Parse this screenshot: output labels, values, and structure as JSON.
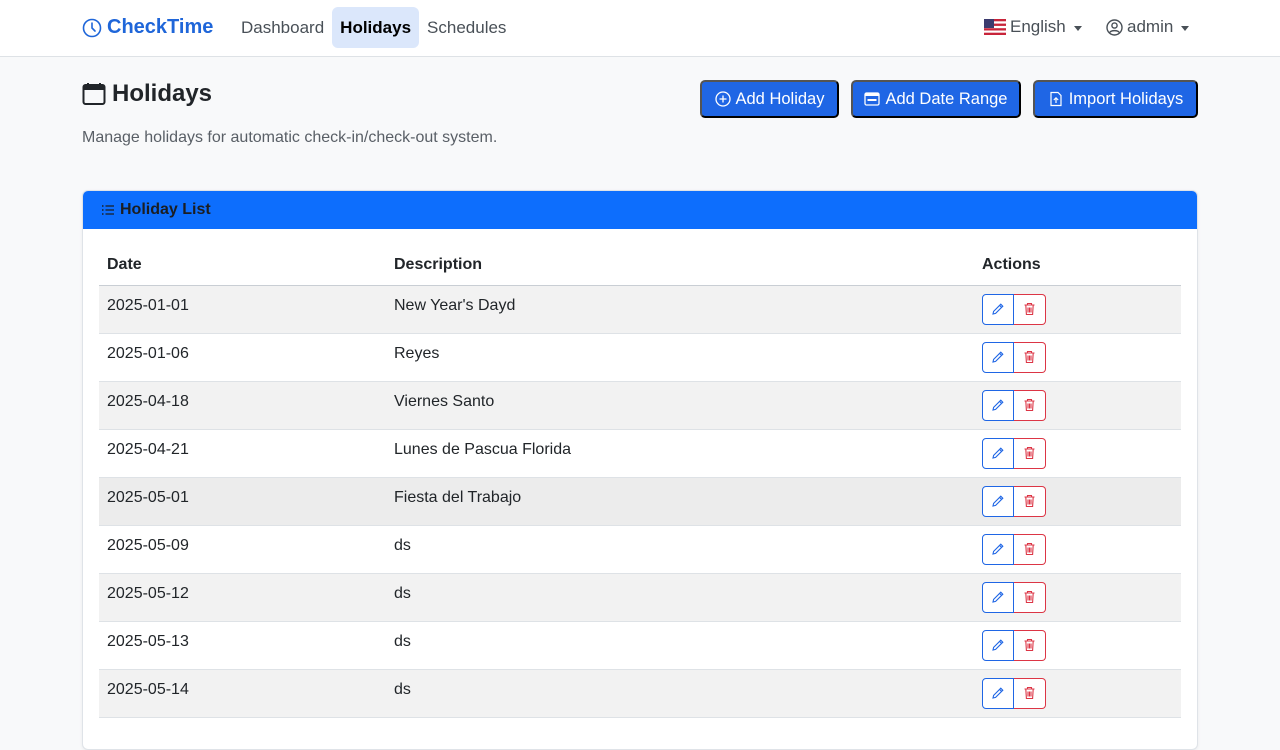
{
  "brand": {
    "name": "CheckTime"
  },
  "nav": {
    "links": [
      {
        "label": "Dashboard"
      },
      {
        "label": "Holidays"
      },
      {
        "label": "Schedules"
      }
    ],
    "language": "English",
    "user": "admin"
  },
  "header": {
    "title": "Holidays",
    "subtitle": "Manage holidays for automatic check-in/check-out system.",
    "buttons": {
      "add_holiday": "Add Holiday",
      "add_date_range": "Add Date Range",
      "import_holidays": "Import Holidays"
    }
  },
  "card": {
    "title": "Holiday List",
    "columns": {
      "date": "Date",
      "description": "Description",
      "actions": "Actions"
    },
    "rows": [
      {
        "date": "2025-01-01",
        "description": "New Year's Dayd"
      },
      {
        "date": "2025-01-06",
        "description": "Reyes"
      },
      {
        "date": "2025-04-18",
        "description": "Viernes Santo"
      },
      {
        "date": "2025-04-21",
        "description": "Lunes de Pascua Florida"
      },
      {
        "date": "2025-05-01",
        "description": "Fiesta del Trabajo"
      },
      {
        "date": "2025-05-09",
        "description": "ds"
      },
      {
        "date": "2025-05-12",
        "description": "ds"
      },
      {
        "date": "2025-05-13",
        "description": "ds"
      },
      {
        "date": "2025-05-14",
        "description": "ds"
      }
    ]
  },
  "colors": {
    "primary": "#1f66e5",
    "card_header": "#0d6efd",
    "danger": "#dc3545",
    "brand": "#1f66d9"
  },
  "icons": {
    "brand": "clock-icon",
    "title": "calendar-icon",
    "add": "plus-circle-icon",
    "range": "calendar-range-icon",
    "import": "file-upload-icon",
    "list": "list-icon",
    "edit": "pencil-icon",
    "delete": "trash-icon",
    "language": "us-flag-icon",
    "user": "user-circle-icon"
  }
}
